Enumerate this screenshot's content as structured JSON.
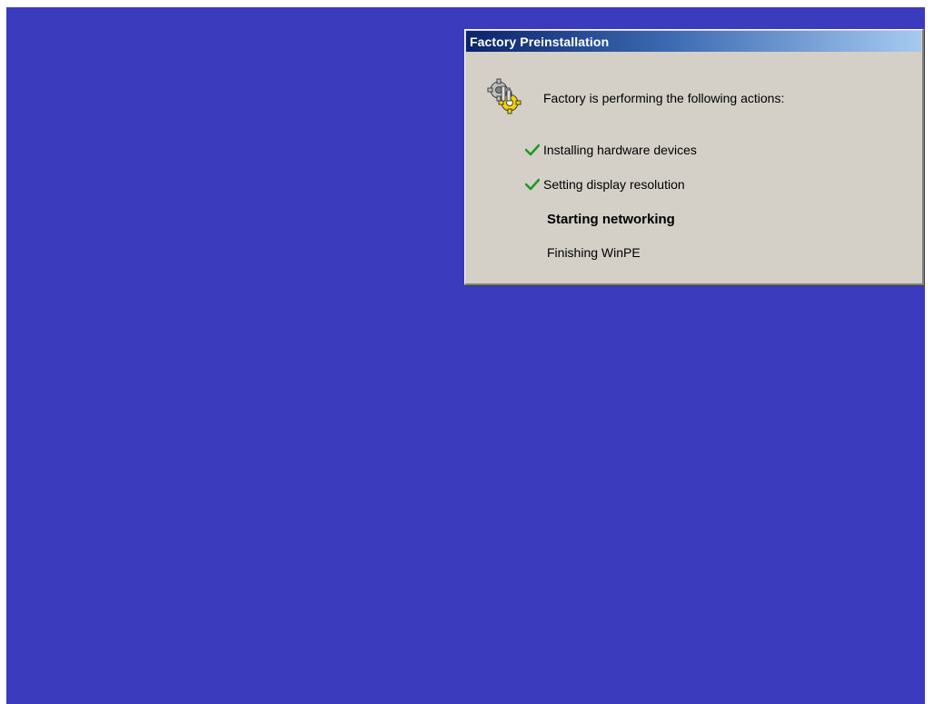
{
  "dialog": {
    "title": "Factory Preinstallation",
    "header": "Factory is performing the following actions:",
    "icon": "gears-icon",
    "steps": [
      {
        "label": "Installing hardware devices",
        "status": "done"
      },
      {
        "label": "Setting display resolution",
        "status": "done"
      },
      {
        "label": "Starting networking",
        "status": "in-progress"
      },
      {
        "label": "Finishing WinPE",
        "status": "pending"
      }
    ]
  },
  "colors": {
    "desktop": "#3a3bbd",
    "dialog_bg": "#d4d0c8",
    "title_start": "#0a246a",
    "title_end": "#a6caf0",
    "check": "#1f9a1f"
  }
}
